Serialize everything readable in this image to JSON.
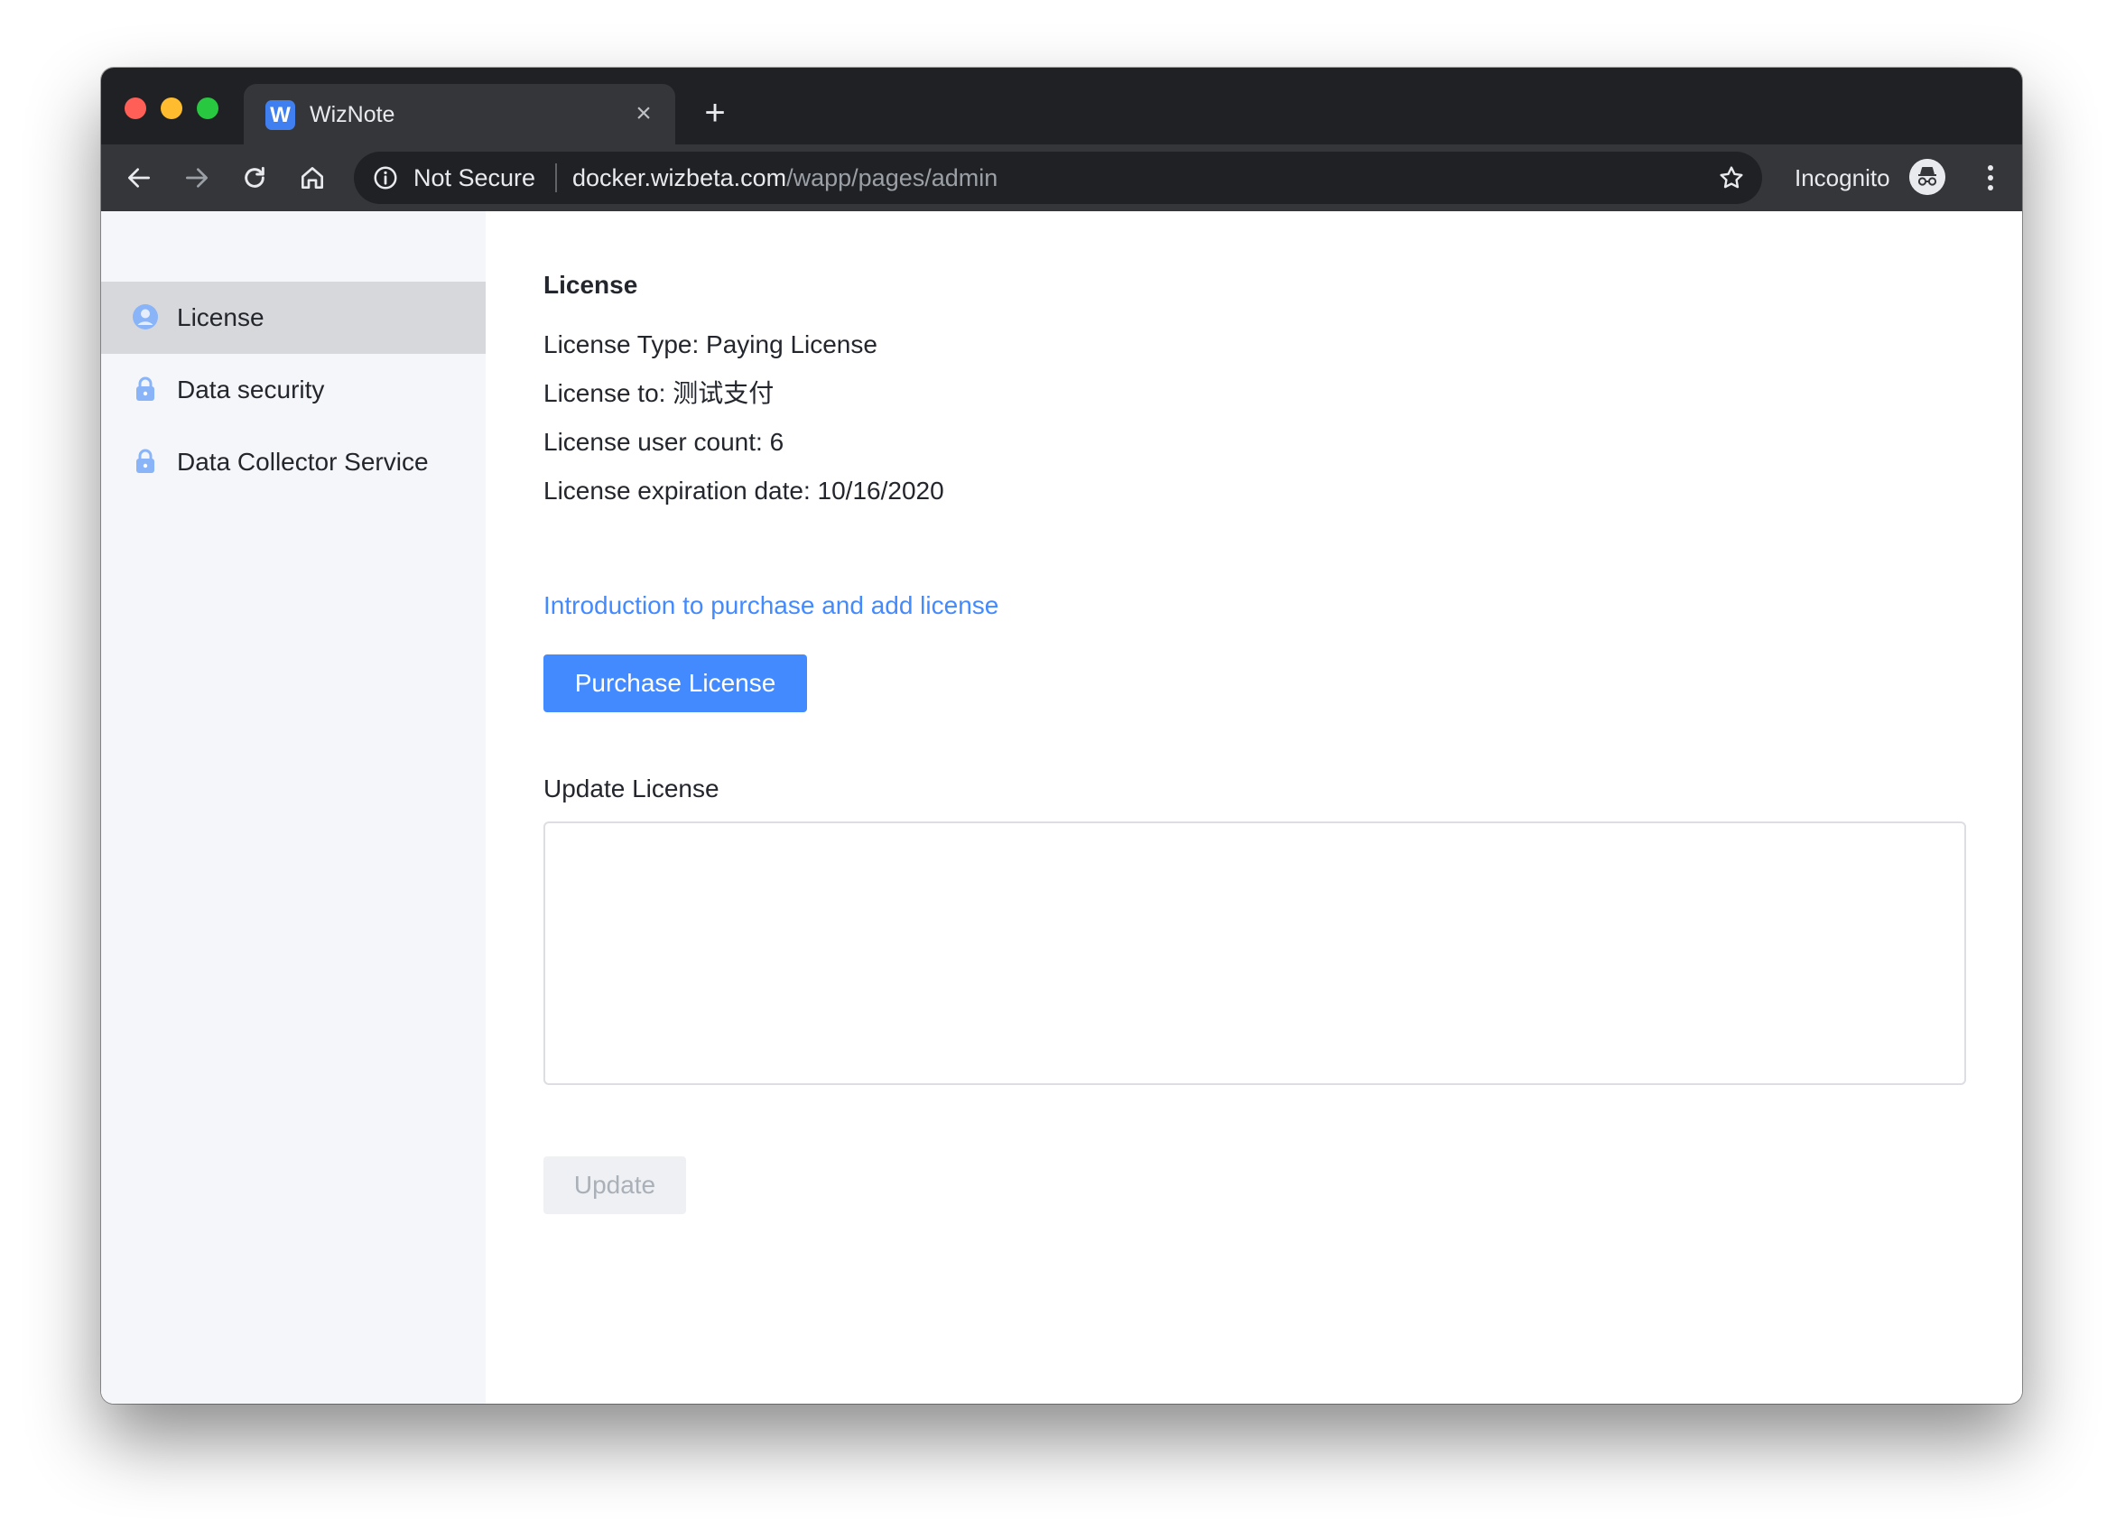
{
  "browser": {
    "tab_title": "WizNote",
    "tab_favicon_letter": "W",
    "security_label": "Not Secure",
    "url_host": "docker.wizbeta.com",
    "url_path": "/wapp/pages/admin",
    "incognito_label": "Incognito",
    "close_glyph": "×",
    "new_tab_glyph": "+"
  },
  "sidebar": {
    "items": [
      {
        "label": "License",
        "icon": "user-circle-icon",
        "active": true
      },
      {
        "label": "Data security",
        "icon": "lock-icon",
        "active": false
      },
      {
        "label": "Data Collector Service",
        "icon": "lock-icon",
        "active": false
      }
    ]
  },
  "main": {
    "title": "License",
    "license_type": "License Type: Paying License",
    "license_to": "License to: 测试支付",
    "user_count": "License user count: 6",
    "expiration": "License expiration date: 10/16/2020",
    "intro_link": "Introduction to purchase and add license",
    "purchase_button": "Purchase License",
    "update_label": "Update License",
    "textarea_value": "",
    "update_button": "Update"
  },
  "colors": {
    "accent": "#448aff",
    "sidebar_bg": "#f5f6f9",
    "sidebar_active": "#d7d8dc",
    "chrome_dark": "#202124",
    "chrome_toolbar": "#35363a"
  }
}
